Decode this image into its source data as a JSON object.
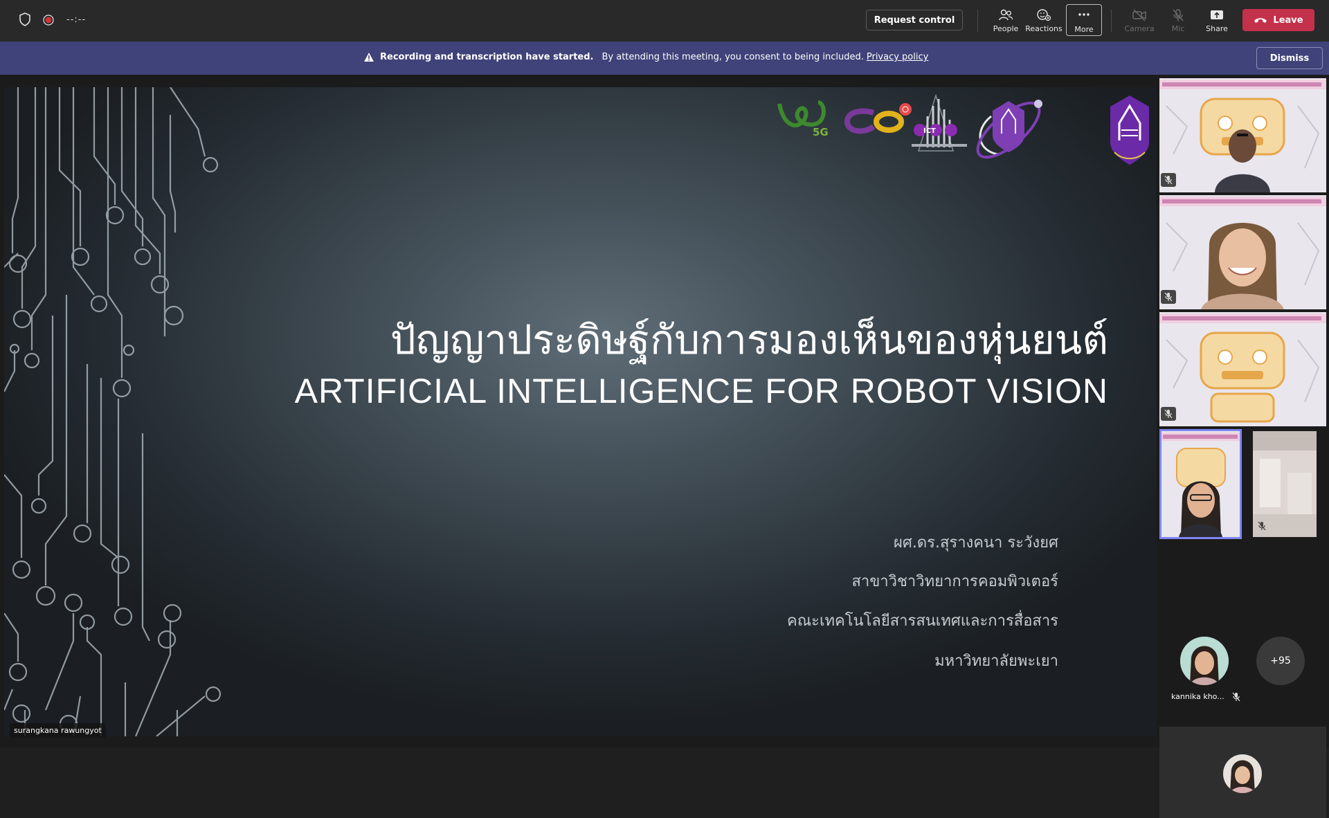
{
  "topbar": {
    "timer": "--:--",
    "request_control_label": "Request control",
    "buttons": {
      "people": "People",
      "reactions": "Reactions",
      "more": "More",
      "camera": "Camera",
      "mic": "Mic",
      "share": "Share"
    },
    "leave_label": "Leave",
    "leave_color": "#c4314b"
  },
  "banner": {
    "bold_text": "Recording and transcription have started.",
    "text": "By attending this meeting, you consent to being included.",
    "link_text": "Privacy policy",
    "dismiss_label": "Dismiss",
    "background": "#3f4379"
  },
  "slide": {
    "title_th": "ปัญญาประดิษฐ์กับการมองเห็นของหุ่นยนต์",
    "title_en": "ARTIFICIAL INTELLIGENCE FOR ROBOT VISION",
    "author": "ผศ.ดร.สุรางคนา  ระวังยศ",
    "department": "สาขาวิชาวิทยาการคอมพิวเตอร์",
    "faculty": "คณะเทคโนโลยีสารสนเทศและการสื่อสาร",
    "university": "มหาวิทยาลัยพะเยา",
    "logos": [
      "5G",
      "ICT"
    ]
  },
  "presenter": {
    "name": "surangkana rawungyot"
  },
  "gallery": {
    "overflow_count": "+95",
    "attendee_name": "kannika kho...",
    "selected_outline_color": "#7f85f5"
  }
}
